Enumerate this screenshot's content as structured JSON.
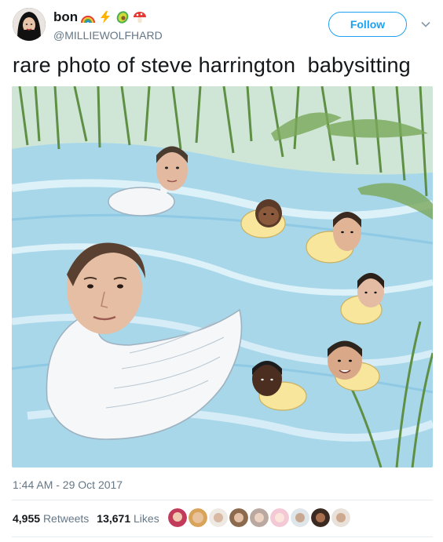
{
  "author": {
    "display_name": "bon",
    "handle": "@MILLIEWOLFHARD",
    "name_emojis": [
      "rainbow-emoji",
      "lightning-emoji",
      "avocado-emoji",
      "mushroom-emoji"
    ]
  },
  "actions": {
    "follow_label": "Follow"
  },
  "tweet": {
    "text": "rare photo of steve harrington  babysitting",
    "timestamp": "1:44 AM - 29 Oct 2017"
  },
  "stats": {
    "retweets_count": "4,955",
    "retweets_label": "Retweets",
    "likes_count": "13,671",
    "likes_label": "Likes"
  },
  "liker_avatars": [
    "liker-1",
    "liker-2",
    "liker-3",
    "liker-4",
    "liker-5",
    "liker-6",
    "liker-7",
    "liker-8",
    "liker-9"
  ],
  "colors": {
    "twitter_blue": "#1da1f2",
    "text_primary": "#14171a",
    "text_secondary": "#657786",
    "divider": "#e6ecf0"
  }
}
